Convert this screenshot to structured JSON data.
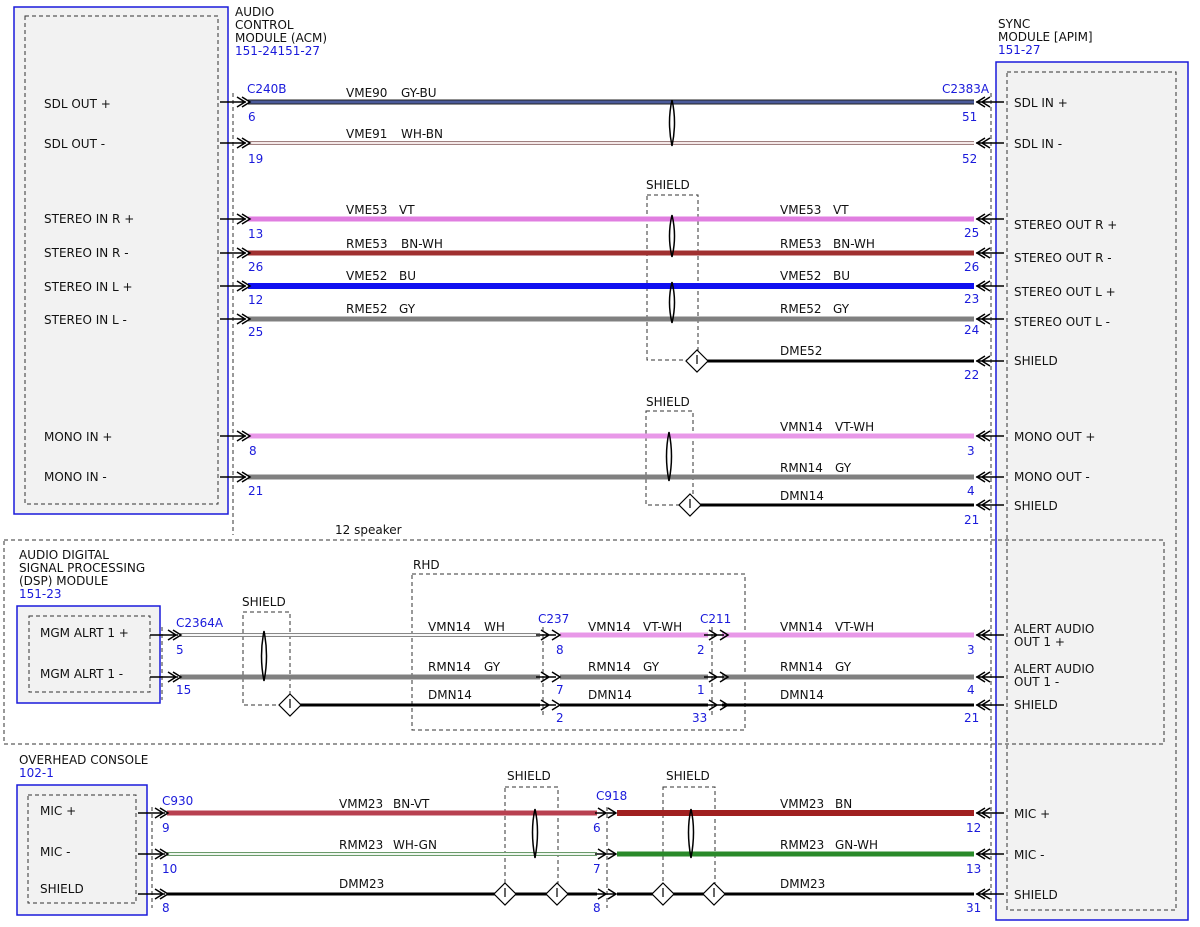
{
  "modules": {
    "acm": {
      "lines": [
        "AUDIO",
        "CONTROL",
        "MODULE (ACM)",
        "151-24151-27"
      ],
      "pins": [
        "SDL OUT +",
        "SDL OUT -",
        "STEREO IN R +",
        "STEREO IN R -",
        "STEREO IN L +",
        "STEREO IN L -",
        "MONO IN +",
        "MONO IN -"
      ]
    },
    "apim": {
      "lines": [
        "SYNC",
        "MODULE [APIM]",
        "151-27"
      ],
      "pins": [
        "SDL IN +",
        "SDL IN -",
        "STEREO OUT R +",
        "STEREO OUT R -",
        "STEREO OUT L +",
        "STEREO OUT L -",
        "SHIELD",
        "MONO OUT +",
        "MONO OUT -",
        "SHIELD",
        "ALERT AUDIO OUT 1 +",
        "ALERT AUDIO OUT 1 -",
        "SHIELD",
        "MIC +",
        "MIC -",
        "SHIELD"
      ]
    },
    "dsp": {
      "lines": [
        "AUDIO DIGITAL",
        "SIGNAL PROCESSING",
        "(DSP) MODULE",
        "151-23"
      ],
      "pins": [
        "MGM ALRT 1 +",
        "MGM ALRT 1 -"
      ]
    },
    "overhead": {
      "lines": [
        "OVERHEAD CONSOLE",
        "102-1"
      ],
      "pins": [
        "MIC +",
        "MIC -",
        "SHIELD"
      ]
    }
  },
  "connectors": [
    "C240B",
    "C2383A",
    "C2364A",
    "C237",
    "C211",
    "C930",
    "C918"
  ],
  "labels": {
    "shield": "SHIELD",
    "speaker_option": "12 speaker",
    "rhd": "RHD"
  },
  "wires": [
    {
      "circuit": "VME90",
      "color": "GY-BU"
    },
    {
      "circuit": "VME91",
      "color": "WH-BN"
    },
    {
      "circuit": "VME53",
      "color": "VT"
    },
    {
      "circuit": "RME53",
      "color": "BN-WH"
    },
    {
      "circuit": "VME52",
      "color": "BU"
    },
    {
      "circuit": "RME52",
      "color": "GY"
    },
    {
      "circuit": "DME52",
      "color": ""
    },
    {
      "circuit": "VMN14",
      "color": "VT-WH"
    },
    {
      "circuit": "RMN14",
      "color": "GY"
    },
    {
      "circuit": "DMN14",
      "color": ""
    },
    {
      "circuit": "VMN14",
      "color": "WH"
    },
    {
      "circuit": "VMM23",
      "color": "BN-VT"
    },
    {
      "circuit": "RMM23",
      "color": "WH-GN"
    },
    {
      "circuit": "DMM23",
      "color": ""
    },
    {
      "circuit": "VMM23",
      "color": "BN"
    },
    {
      "circuit": "RMM23",
      "color": "GN-WH"
    }
  ],
  "pin_numbers": [
    "6",
    "51",
    "19",
    "52",
    "13",
    "25",
    "26",
    "26",
    "12",
    "23",
    "25",
    "24",
    "22",
    "8",
    "3",
    "21",
    "4",
    "21",
    "5",
    "8",
    "2",
    "3",
    "15",
    "7",
    "1",
    "4",
    "2",
    "33",
    "21",
    "9",
    "6",
    "12",
    "10",
    "7",
    "13",
    "8",
    "8",
    "31"
  ],
  "wire_colors": {
    "GY-BU": "#4a5a9a",
    "WH-BN": "#c8a8a0",
    "VT": "#e07ee0",
    "BN-WH": "#a03030",
    "BU": "#1010f0",
    "GY": "#808080",
    "BLACK": "#000000",
    "VT-WH": "#e898e8",
    "WH": "#d8d8d8",
    "BN-VT": "#b84050",
    "WH-GN": "#a8d0a8",
    "BN": "#a02020",
    "GN-WH": "#2a8a2a"
  },
  "accent": "#1a1adb"
}
